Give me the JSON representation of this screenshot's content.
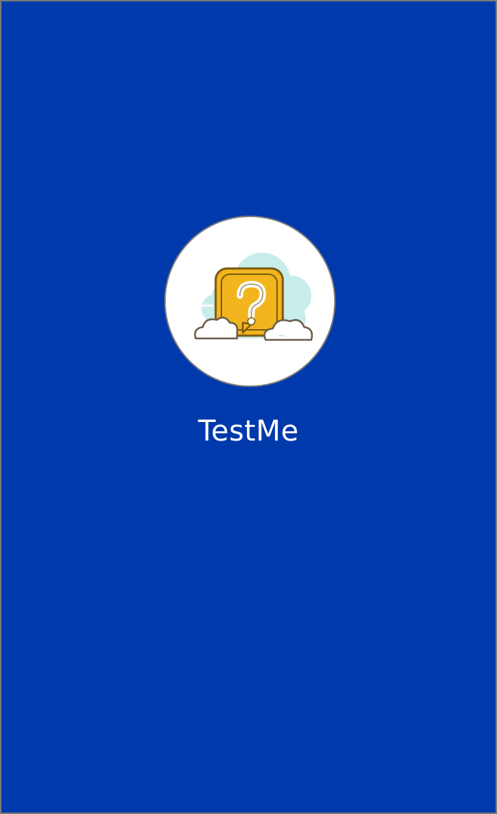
{
  "app": {
    "name": "TestMe",
    "logo_icon": "question-mark-bubble-icon"
  },
  "colors": {
    "background": "#0039ac",
    "logo_circle": "#ffffff",
    "bubble_fill": "#f2b51d",
    "bubble_outline": "#7a5b12",
    "cloud_back": "#c8ecea",
    "cloud_front": "#ffffff",
    "text": "#ffffff"
  }
}
